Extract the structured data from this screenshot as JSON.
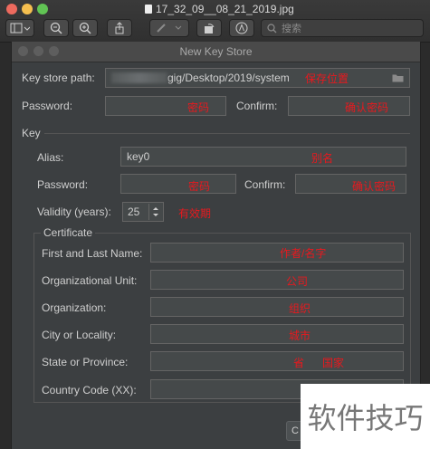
{
  "preview": {
    "filename": "17_32_09__08_21_2019.jpg",
    "search_placeholder": "搜索"
  },
  "dialog": {
    "title": "New Key Store",
    "key_store_path": {
      "label": "Key store path:",
      "value": "gig/Desktop/2019/system",
      "annotation": "保存位置"
    },
    "password": {
      "label": "Password:",
      "annotation": "密码"
    },
    "confirm": {
      "label": "Confirm:",
      "annotation": "确认密码"
    },
    "key_section": "Key",
    "alias": {
      "label": "Alias:",
      "value": "key0",
      "annotation": "别名"
    },
    "key_password": {
      "label": "Password:",
      "annotation": "密码"
    },
    "key_confirm": {
      "label": "Confirm:",
      "annotation": "确认密码"
    },
    "validity": {
      "label": "Validity (years):",
      "value": "25",
      "annotation": "有效期"
    },
    "certificate": {
      "title": "Certificate",
      "first_last": {
        "label": "First and Last Name:",
        "annotation": "作者/名字"
      },
      "org_unit": {
        "label": "Organizational Unit:",
        "annotation": "公司"
      },
      "organization": {
        "label": "Organization:",
        "annotation": "组织"
      },
      "city": {
        "label": "City or Locality:",
        "annotation": "城市"
      },
      "state": {
        "label": "State or Province:",
        "annotation_a": "省",
        "annotation_b": "国家"
      },
      "country": {
        "label": "Country Code (XX):"
      }
    },
    "ok_stub": "C"
  },
  "watermark": "软件技巧"
}
